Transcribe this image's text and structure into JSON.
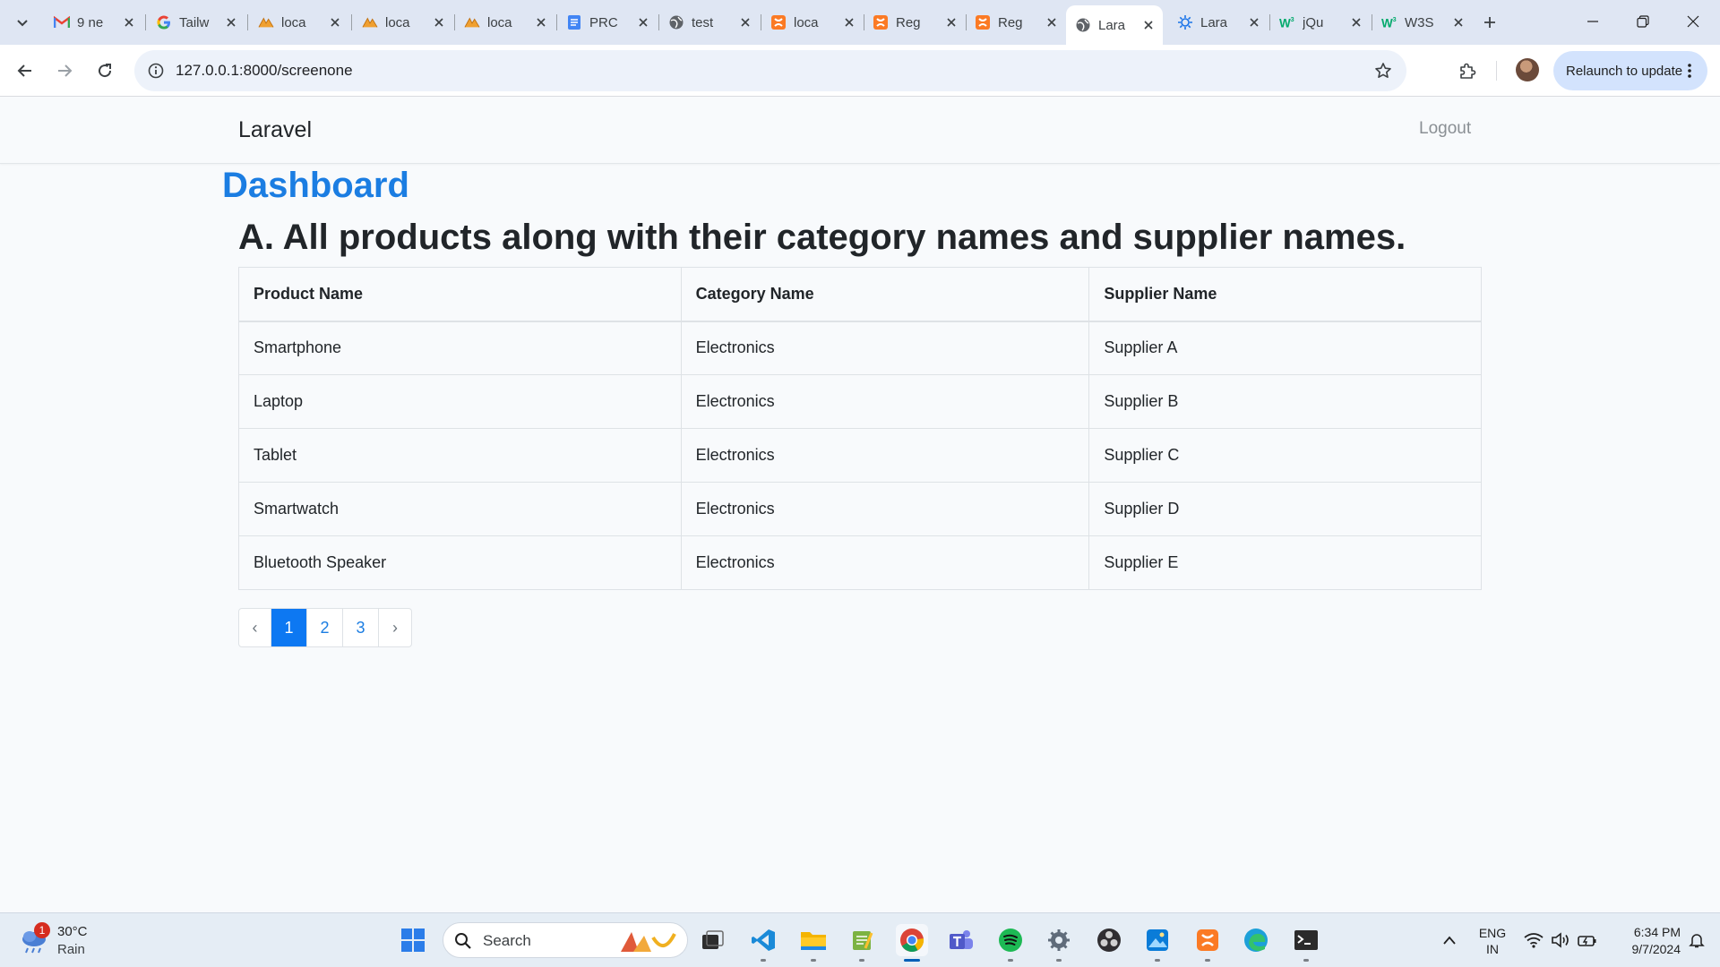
{
  "browser": {
    "tabs": [
      {
        "title": "9 ne",
        "icon": "gmail-icon"
      },
      {
        "title": "Tailw",
        "icon": "google-icon"
      },
      {
        "title": "loca",
        "icon": "phpmyadmin-icon"
      },
      {
        "title": "loca",
        "icon": "phpmyadmin-icon"
      },
      {
        "title": "loca",
        "icon": "phpmyadmin-icon"
      },
      {
        "title": "PRC",
        "icon": "docs-icon"
      },
      {
        "title": "test",
        "icon": "globe-icon"
      },
      {
        "title": "loca",
        "icon": "xampp-icon"
      },
      {
        "title": "Reg",
        "icon": "xampp-icon"
      },
      {
        "title": "Reg",
        "icon": "xampp-icon"
      },
      {
        "title": "Lara",
        "icon": "globe-icon"
      },
      {
        "title": "Lara",
        "icon": "settings-sun-icon"
      },
      {
        "title": "jQu",
        "icon": "w3schools-icon"
      },
      {
        "title": "W3S",
        "icon": "w3schools-icon"
      }
    ],
    "active_tab_index": 10,
    "url": "127.0.0.1:8000/screenone",
    "relaunch_label": "Relaunch to update"
  },
  "app": {
    "brand": "Laravel",
    "logout_label": "Logout",
    "dashboard_title": "Dashboard",
    "section_title": "A. All products along with their category names and supplier names.",
    "table": {
      "headers": {
        "product": "Product Name",
        "category": "Category Name",
        "supplier": "Supplier Name"
      },
      "rows": [
        {
          "product": "Smartphone",
          "category": "Electronics",
          "supplier": "Supplier A"
        },
        {
          "product": "Laptop",
          "category": "Electronics",
          "supplier": "Supplier B"
        },
        {
          "product": "Tablet",
          "category": "Electronics",
          "supplier": "Supplier C"
        },
        {
          "product": "Smartwatch",
          "category": "Electronics",
          "supplier": "Supplier D"
        },
        {
          "product": "Bluetooth Speaker",
          "category": "Electronics",
          "supplier": "Supplier E"
        }
      ]
    },
    "pagination": {
      "prev": "‹",
      "pages": [
        "1",
        "2",
        "3"
      ],
      "current": "1",
      "next": "›"
    }
  },
  "taskbar": {
    "weather": {
      "temp": "30°C",
      "condition": "Rain",
      "badge": "1"
    },
    "search_label": "Search",
    "language": {
      "line1": "ENG",
      "line2": "IN"
    },
    "clock": {
      "time": "6:34 PM",
      "date": "9/7/2024"
    }
  },
  "colors": {
    "accent": "#1b7de2",
    "active_page": "#0d78f2",
    "tab_strip": "#dfe6f3",
    "relaunch": "#d3e3fd"
  }
}
